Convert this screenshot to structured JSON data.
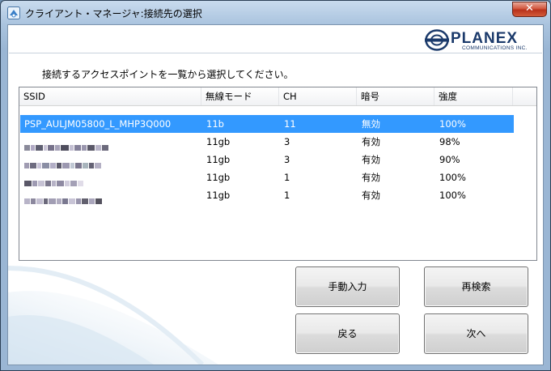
{
  "window": {
    "title": "クライアント・マネージャ:接続先の選択",
    "close_label": "✕"
  },
  "logo": {
    "name": "PLANEX",
    "sub": "COMMUNICATIONS INC."
  },
  "instruction": "接続するアクセスポイントを一覧から選択してください。",
  "table": {
    "columns": [
      "SSID",
      "無線モード",
      "CH",
      "暗号",
      "強度"
    ],
    "rows": [
      {
        "ssid": "PSP_AULJM05800_L_MHP3Q000",
        "mode": "11b",
        "ch": "11",
        "enc": "無効",
        "strength": "100%",
        "selected": true
      },
      {
        "ssid": "",
        "mode": "11gb",
        "ch": "3",
        "enc": "有効",
        "strength": "98%",
        "selected": false
      },
      {
        "ssid": "",
        "mode": "11gb",
        "ch": "3",
        "enc": "有効",
        "strength": "90%",
        "selected": false
      },
      {
        "ssid": "",
        "mode": "11gb",
        "ch": "1",
        "enc": "有効",
        "strength": "100%",
        "selected": false
      },
      {
        "ssid": "",
        "mode": "11gb",
        "ch": "1",
        "enc": "有効",
        "strength": "100%",
        "selected": false
      }
    ]
  },
  "buttons": {
    "manual": "手動入力",
    "research": "再検索",
    "back": "戻る",
    "next": "次へ"
  },
  "colors": {
    "selection": "#3399ff",
    "close": "#c7432a",
    "brand": "#1b3a6b"
  }
}
